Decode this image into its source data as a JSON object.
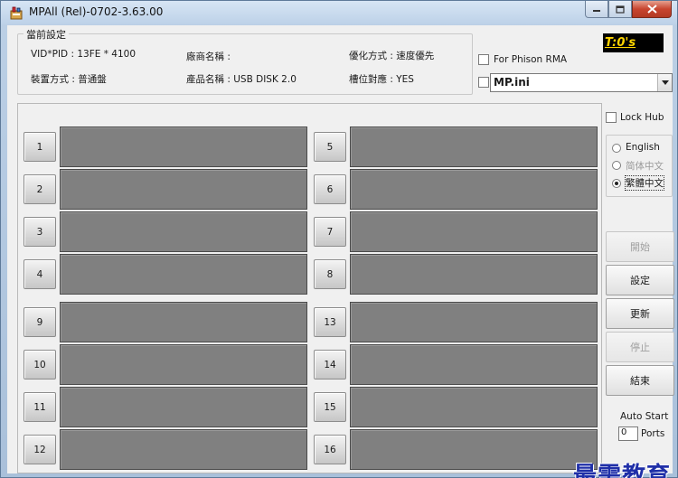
{
  "window": {
    "title": "MPAll (Rel)-0702-3.63.00",
    "close_label": "x"
  },
  "settings": {
    "legend": "當前設定",
    "vid_pid": "VID*PID : 13FE * 4100",
    "vendor_name": "廠商名稱 :",
    "optimize_mode": "優化方式 : 速度優先",
    "device_mode": "裝置方式 : 普通盤",
    "product_name": "產品名稱 : USB DISK 2.0",
    "slot_mapping": "槽位對應 : YES"
  },
  "timer": "T:0's",
  "for_phison_rma": {
    "label": "For Phison RMA",
    "checked": false
  },
  "ini_select": {
    "value": "MP.ini",
    "checked": false
  },
  "lock_hub": {
    "label": "Lock Hub",
    "checked": false
  },
  "language": {
    "options": [
      {
        "label": "English",
        "selected": false,
        "enabled": true
      },
      {
        "label": "简体中文",
        "selected": false,
        "enabled": false
      },
      {
        "label": "繁體中文",
        "selected": true,
        "enabled": true
      }
    ]
  },
  "actions": {
    "start": "開始",
    "settings": "設定",
    "update": "更新",
    "stop": "停止",
    "end": "結束"
  },
  "auto_start": {
    "label": "Auto Start",
    "value": "0",
    "ports_label": "Ports"
  },
  "ports": {
    "left": [
      "1",
      "2",
      "3",
      "4",
      "9",
      "10",
      "11",
      "12"
    ],
    "right": [
      "5",
      "6",
      "7",
      "8",
      "13",
      "14",
      "15",
      "16"
    ]
  },
  "watermark": "最需教育",
  "colors": {
    "port_box": "#808080",
    "timer_bg": "#000000",
    "timer_fg": "#ffd400",
    "watermark": "#1f2fa8"
  }
}
